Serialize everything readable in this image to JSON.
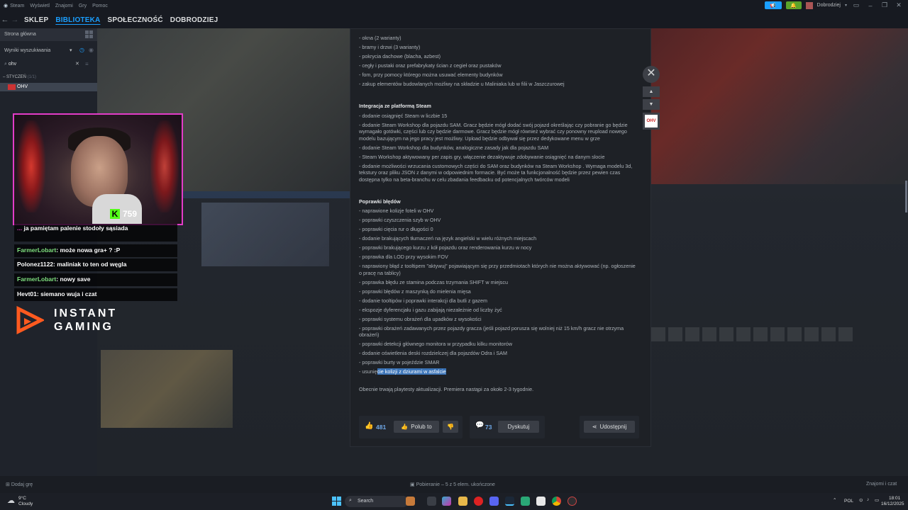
{
  "titlebar": {
    "app": "Steam",
    "menu": [
      "Steam",
      "Wyświetl",
      "Znajomi",
      "Gry",
      "Pomoc"
    ],
    "user": "Dobrodziej"
  },
  "nav": {
    "items": [
      "SKLEP",
      "BIBLIOTEKA",
      "SPOŁECZNOŚĆ",
      "DOBRODZIEJ"
    ],
    "active": "BIBLIOTEKA"
  },
  "sidebar": {
    "home": "Strona główna",
    "filter": "Wyniki wyszukiwania",
    "search_value": "ohv",
    "section": "STYCZEŃ",
    "section_count": "(1/1)",
    "game": "OHV"
  },
  "bottom_bar": {
    "add_game": "Dodaj grę",
    "download": "Pobieranie – 5 z 5 elem. ukończone",
    "friends": "Znajomi i czat"
  },
  "modal": {
    "top_lines": [
      "- okna (2 warianty)",
      "- bramy i drzwi (3 warianty)",
      "- pokrycia dachowe (blacha, azbest)",
      "- cegły i pustaki oraz prefabrykaty ścian z cegieł oraz pustaków",
      "- fom, przy pomocy którego można usuwać elementy budynków",
      "- zakup elementów budowlanych możliwy na składzie u Maliniaka lub w filii w Jaszczurowej"
    ],
    "steam_head": "Integracja ze platformą Steam",
    "steam_lines": [
      "- dodanie osiągnięć Steam w liczbie 15",
      "- dodanie Steam Workshop dla pojazdu SAM. Gracz będzie mógł dodać swój pojazd określając czy pobranie go będzie wymagało gotówki, części lub czy będzie darmowe. Gracz będzie mógł również wybrać czy ponowny reupload nowego modelu bazującym na jego pracy jest możliwy. Upload będzie odbywał się przez dedykowane menu w grze",
      "- dodanie Steam Workshop dla budynków, analogiczne zasady jak dla pojazdu SAM",
      "- Steam Workshop aktywowany per zapis gry, włączenie dezaktywuje zdobywanie osiągnięć na danym slocie",
      "- dodanie możliwości wrzucania customowych części do SAM oraz budynków na Steam Workshop . Wymaga modelu 3d, tekstury oraz pliku JSON z danymi w odpowiednim formacie. Być może ta funkcjonalność będzie przez pewien czas dostępna tylko na beta-branchu w celu zbadania feedbacku od potencjalnych twórców modeli"
    ],
    "fix_head": "Poprawki błędów",
    "fix_lines": [
      "- naprawione kolizje foteli w OHV",
      "- poprawki czyszczenia szyb w OHV",
      "- poprawki cięcia rur o długości 0",
      "- dodanie brakujących tłumaczeń na język angielski w wielu różnych miejscach",
      "- poprawki brakującego kurzu z kół pojazdu oraz renderowania kurzu w nocy",
      "- poprawka dla LOD przy wysokim FOV",
      "- naprawiony błąd z tooltipem \"aktywuj\" pojawiającym się przy przedmiotach których nie można aktywować (np. ogłoszenie o pracę na tablicy)",
      "- poprawka błędu ze stamina podczas trzymania SHIFT w miejscu",
      "- poprawki błędów z maszynką do mielenia mięsa",
      "- dodanie tooltipów i poprawki interakcji dla butli z gazem",
      "- ekspozje dyferencjału i gazu zabijają niezależnie od liczby żyć",
      "- poprawki systemu obrażeń dla upadków z wysokości",
      "- poprawki obrażeń zadawanych przez pojazdy gracza (jeśli pojazd porusza się wolniej niż 15 km/h gracz nie otrzyma obrażeń)",
      "- poprawki detekcji głównego monitora w przypadku kilku monitorów",
      "- dodanie oświetlenia deski rozdzielczej dla pojazdów Odra i SAM",
      "- poprawki burty w pojeździe SMAR"
    ],
    "last_line_pre": "- usunię",
    "last_line_hl": "cie kolizji z dziurami w asfalcie",
    "closing": "Obecnie trwają playtesty aktualizacji. Premiera nastąpi za około 2-3 tygodnie.",
    "likes": "481",
    "like_label": "Polub to",
    "comments": "73",
    "discuss_label": "Dyskutuj",
    "share_label": "Udostępnij",
    "thumb_label": "OHV"
  },
  "stream": {
    "kick_viewers": "759",
    "chat_top_user": "...",
    "chat_top_text": "ja pamiętam palenie stodoły sąsiada",
    "chat": [
      {
        "user": "FarmerLobart",
        "text": "może nowa gra+ ? :P",
        "color": "green"
      },
      {
        "user": "Polonez1122",
        "text": "maliniak to ten od węgla",
        "color": "white"
      },
      {
        "user": "FarmerLobart",
        "text": "nowy save",
        "color": "green"
      },
      {
        "user": "Hevt01",
        "text": "siemano wuja i czat",
        "color": "white"
      }
    ],
    "brand_line1": "INSTANT",
    "brand_line2": "GAMING"
  },
  "taskbar": {
    "weather_temp": "9°C",
    "weather_desc": "Cloudy",
    "search": "Search",
    "lang": "POL",
    "time": "18:01",
    "date": "16/12/2025"
  }
}
